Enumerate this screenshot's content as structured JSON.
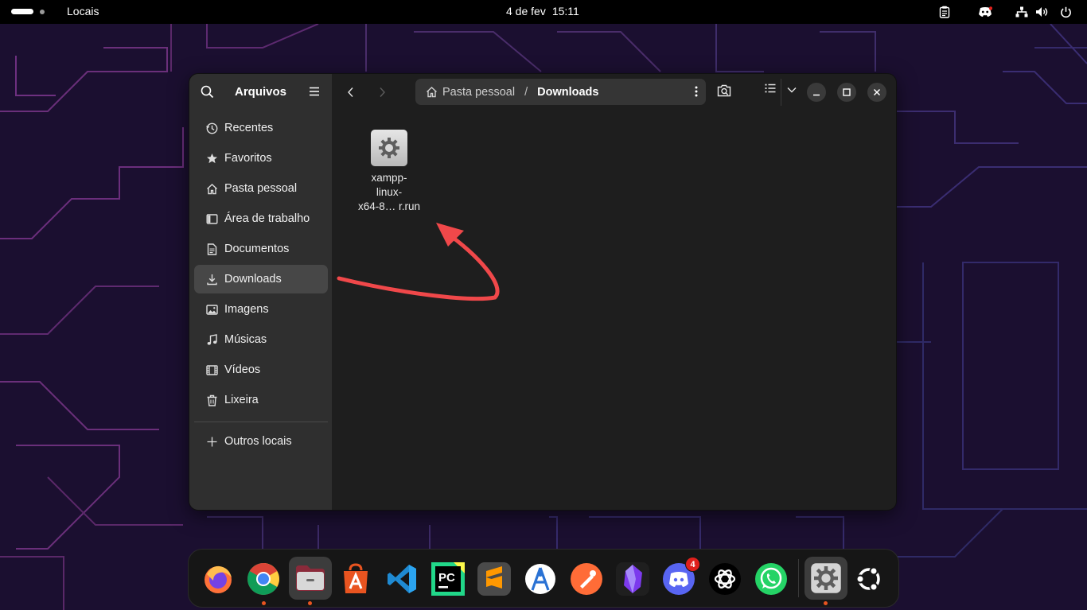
{
  "topbar": {
    "app_name": "Locais",
    "date": "4 de fev",
    "time": "15:11",
    "tray_icons": [
      "clipboard-icon",
      "discord-tray-icon",
      "network-icon",
      "volume-icon",
      "power-icon"
    ]
  },
  "window": {
    "sidebar": {
      "title": "Arquivos",
      "items": [
        {
          "label": "Recentes",
          "icon": "clock-icon"
        },
        {
          "label": "Favoritos",
          "icon": "star-icon"
        },
        {
          "label": "Pasta pessoal",
          "icon": "home-icon"
        },
        {
          "label": "Área de trabalho",
          "icon": "desktop-icon"
        },
        {
          "label": "Documentos",
          "icon": "document-icon"
        },
        {
          "label": "Downloads",
          "icon": "download-icon",
          "active": true
        },
        {
          "label": "Imagens",
          "icon": "image-icon"
        },
        {
          "label": "Músicas",
          "icon": "music-icon"
        },
        {
          "label": "Vídeos",
          "icon": "video-icon"
        },
        {
          "label": "Lixeira",
          "icon": "trash-icon"
        }
      ],
      "other_locations": "Outros locais"
    },
    "pathbar": {
      "home": "Pasta pessoal",
      "current": "Downloads"
    },
    "files": [
      {
        "name": "xampp-linux-x64-8… r.run",
        "name_lines": [
          "xampp-",
          "linux-",
          "x64-8… r.run"
        ],
        "icon": "executable-gear-icon"
      }
    ]
  },
  "dock": {
    "apps": [
      {
        "name": "Firefox",
        "icon": "firefox-icon"
      },
      {
        "name": "Google Chrome",
        "icon": "chrome-icon",
        "running": true
      },
      {
        "name": "Arquivos",
        "icon": "files-icon",
        "running": true,
        "active": true
      },
      {
        "name": "App Center",
        "icon": "app-center-icon"
      },
      {
        "name": "Visual Studio Code",
        "icon": "vscode-icon"
      },
      {
        "name": "PyCharm",
        "icon": "pycharm-icon",
        "label": "PC"
      },
      {
        "name": "Sublime Text",
        "icon": "sublime-icon",
        "label": "S"
      },
      {
        "name": "Android Studio",
        "icon": "android-studio-icon"
      },
      {
        "name": "Postman",
        "icon": "postman-icon"
      },
      {
        "name": "Obsidian",
        "icon": "obsidian-icon"
      },
      {
        "name": "Discord",
        "icon": "discord-icon",
        "badge": "4"
      },
      {
        "name": "ChatGPT",
        "icon": "chatgpt-icon"
      },
      {
        "name": "WhatsApp",
        "icon": "whatsapp-icon"
      },
      {
        "name": "Configurações",
        "icon": "settings-icon",
        "running": true
      },
      {
        "name": "Mostrar aplicativos",
        "icon": "ubuntu-icon"
      }
    ]
  },
  "colors": {
    "accent": "#e95420",
    "annotation_arrow": "#f0484a",
    "wallpaper_bg": "#1a0f2e"
  }
}
